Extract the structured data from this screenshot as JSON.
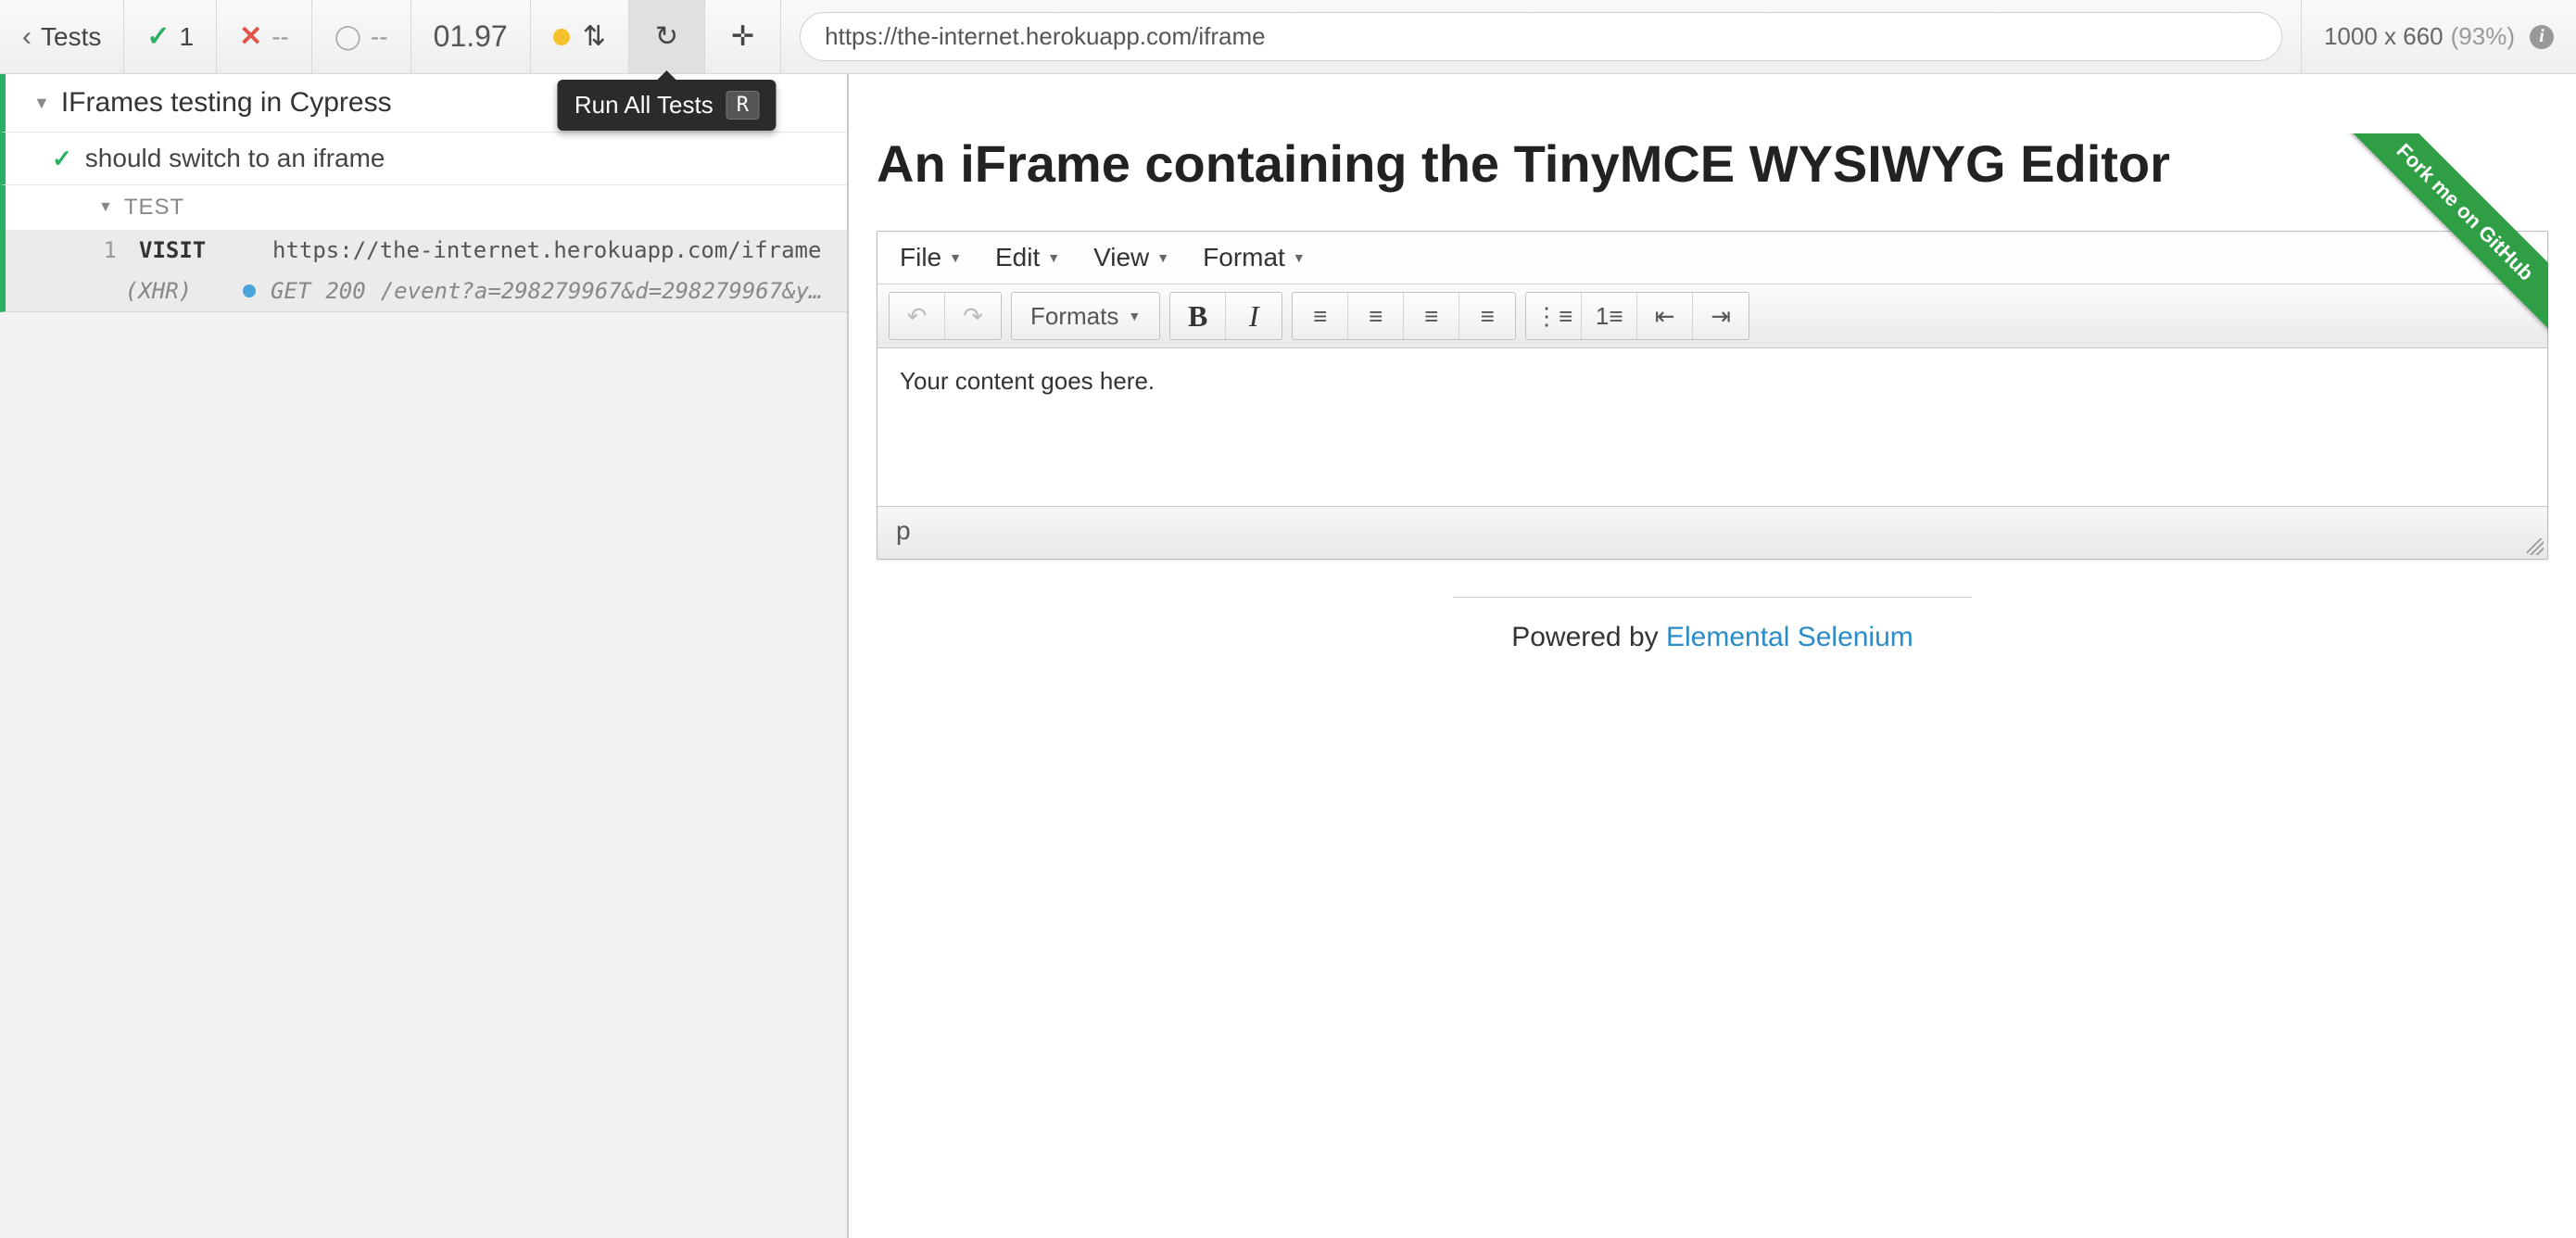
{
  "header": {
    "tests_label": "Tests",
    "passed_count": "1",
    "failed_count": "--",
    "pending_count": "--",
    "duration": "01.97",
    "url": "https://the-internet.herokuapp.com/iframe",
    "viewport_dims": "1000 x 660",
    "viewport_scale": "(93%)",
    "tooltip_label": "Run All Tests",
    "tooltip_key": "R"
  },
  "spec": {
    "title": "IFrames testing in Cypress",
    "tests": [
      {
        "name": "should switch to an iframe",
        "status": "passed"
      }
    ],
    "section_label": "TEST",
    "commands": [
      {
        "num": "1",
        "name": "VISIT",
        "message": "https://the-internet.herokuapp.com/iframe"
      }
    ],
    "xhr": {
      "label": "(XHR)",
      "method": "GET",
      "status": "200",
      "path": "/event?a=298279967&d=298279967&y=false&…"
    }
  },
  "aut": {
    "ribbon": "Fork me on GitHub",
    "heading": "An iFrame containing the TinyMCE WYSIWYG Editor",
    "editor": {
      "menus": {
        "file": "File",
        "edit": "Edit",
        "view": "View",
        "format": "Format"
      },
      "formats_label": "Formats",
      "content": "Your content goes here.",
      "statusbar_path": "p"
    },
    "footer": {
      "prefix": "Powered by ",
      "link": "Elemental Selenium"
    }
  }
}
